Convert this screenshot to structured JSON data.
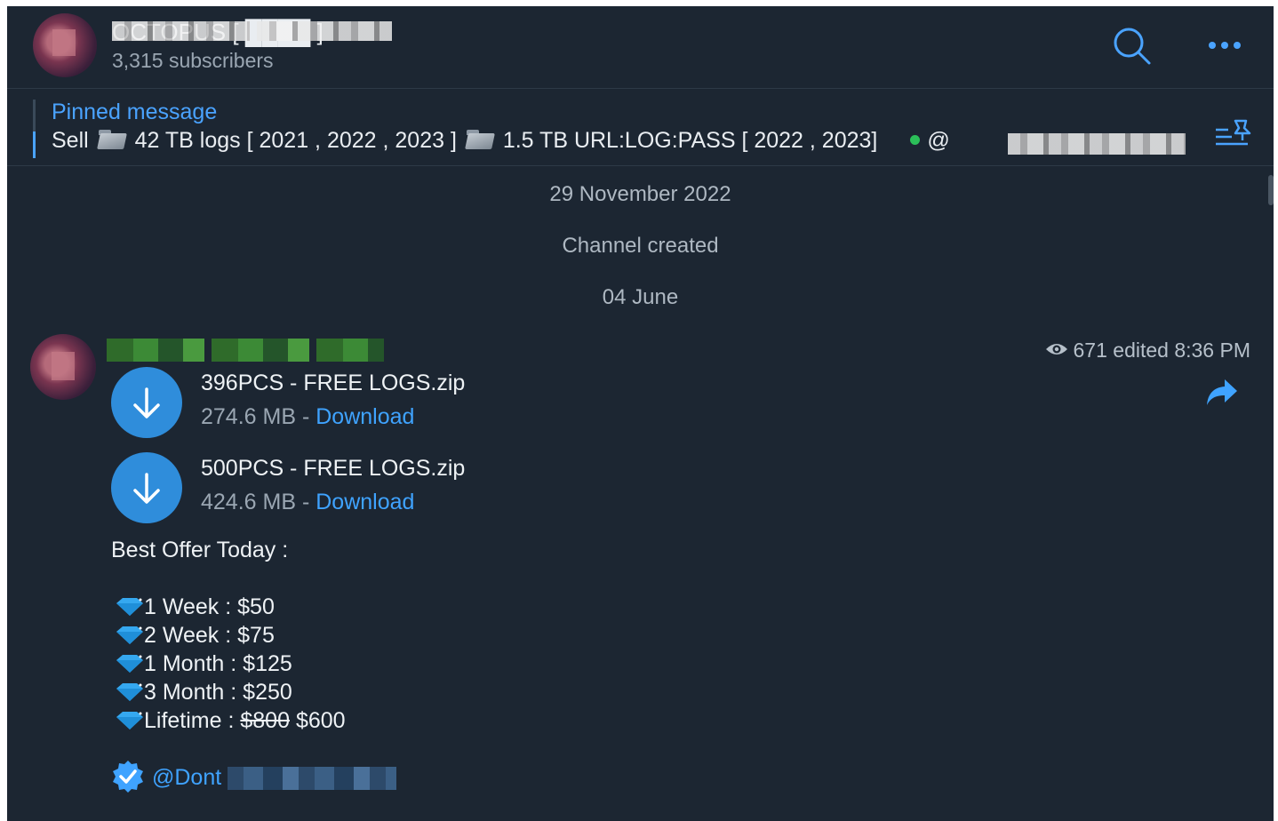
{
  "header": {
    "channel_title": "OCTOPUS [ ████ ]",
    "subscribers": "3,315 subscribers",
    "search_icon": "search-icon",
    "more_icon": "more-icon"
  },
  "pinned": {
    "label": "Pinned message",
    "text_sell": "Sell",
    "text_logs": "42 TB logs [ 2021 , 2022 , 2023 ]",
    "text_urls": "1.5 TB URL:LOG:PASS [ 2022 , 2023]",
    "text_handle": "@",
    "icon": "pinned-list-icon"
  },
  "service": {
    "date_1": "29 November 2022",
    "created": "Channel created",
    "date_2": "04 June"
  },
  "post": {
    "views": "671",
    "edited": "edited 8:36 PM",
    "files": [
      {
        "name": "396PCS - FREE LOGS.zip",
        "size": "274.6 MB - ",
        "action": "Download"
      },
      {
        "name": "500PCS - FREE LOGS.zip",
        "size": "424.6 MB - ",
        "action": "Download"
      }
    ],
    "offer_title": "Best Offer Today :",
    "plans": [
      {
        "label": "1 Week : $50"
      },
      {
        "label": "2 Week : $75"
      },
      {
        "label": "1 Month : $125"
      },
      {
        "label": "3 Month : $250"
      },
      {
        "label": "Lifetime : ",
        "old_price": "$800",
        "new_price": " $600"
      }
    ],
    "mention": "@Dont"
  },
  "colors": {
    "background": "#1c2632",
    "accent": "#4aa3ff",
    "download_button": "#2f8ddb",
    "online_dot": "#2bbf59"
  }
}
